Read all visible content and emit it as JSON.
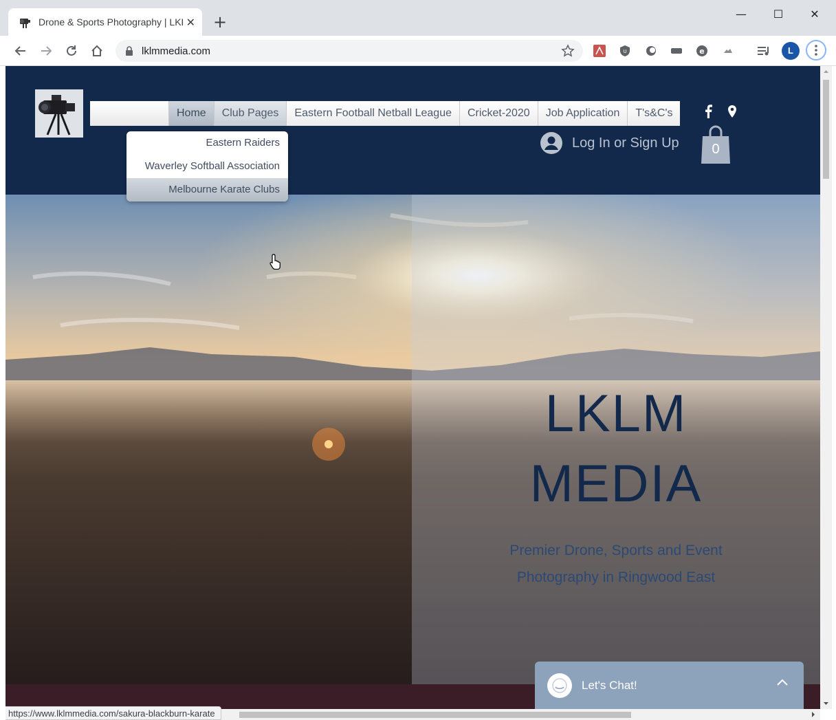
{
  "browser": {
    "tab_title": "Drone & Sports Photography | LKLM Media",
    "url": "lklmmedia.com",
    "status_url": "https://www.lklmmedia.com/sakura-blackburn-karate"
  },
  "site": {
    "nav": [
      {
        "label": "Home"
      },
      {
        "label": "Club Pages"
      },
      {
        "label": "Eastern Football Netball League"
      },
      {
        "label": "Cricket-2020"
      },
      {
        "label": "Job Application"
      },
      {
        "label": "T's&C's"
      }
    ],
    "dropdown": [
      {
        "label": "Eastern Raiders"
      },
      {
        "label": "Waverley Softball Association"
      },
      {
        "label": "Melbourne Karate Clubs"
      }
    ],
    "login_label": "Log In or Sign Up",
    "cart_count": "0",
    "hero": {
      "title_line1": "LKLM",
      "title_line2": "MEDIA",
      "subtitle_line1": "Premier Drone, Sports and Event",
      "subtitle_line2": "Photography in Ringwood East"
    },
    "chat_label": "Let's Chat!"
  },
  "colors": {
    "header_bg": "#13294b",
    "nav_text": "#4d5b6e",
    "hero_title": "#13294b",
    "hero_sub": "#2a4a75",
    "chat_bg": "#8da2bb"
  },
  "icons": [
    "back-icon",
    "forward-icon",
    "reload-icon",
    "home-icon",
    "lock-icon",
    "star-icon",
    "facebook-icon",
    "location-pin-icon",
    "user-icon",
    "shopping-bag-icon",
    "smiley-icon",
    "chevron-up-icon",
    "hand-cursor-icon"
  ]
}
